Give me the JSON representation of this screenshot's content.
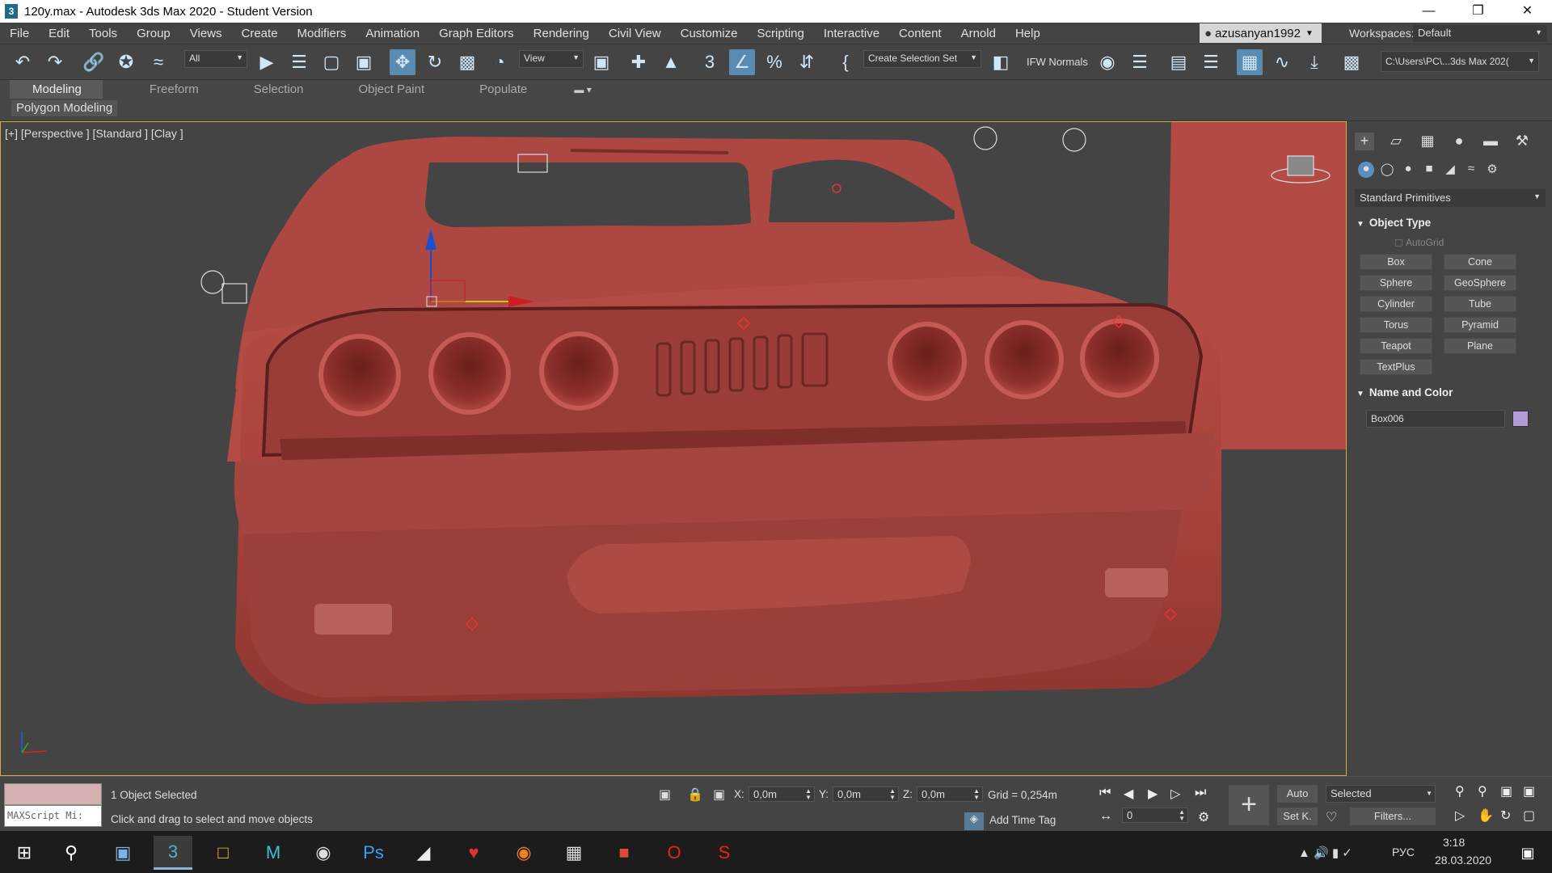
{
  "window": {
    "title": "120y.max - Autodesk 3ds Max 2020 - Student Version",
    "controls": [
      "—",
      "❐",
      "✕"
    ]
  },
  "menu": {
    "items": [
      "File",
      "Edit",
      "Tools",
      "Group",
      "Views",
      "Create",
      "Modifiers",
      "Animation",
      "Graph Editors",
      "Rendering",
      "Civil View",
      "Customize",
      "Scripting",
      "Interactive",
      "Content",
      "Arnold",
      "Help"
    ],
    "user": "azusanyan1992",
    "workspaces_label": "Workspaces:",
    "workspace": "Default"
  },
  "toolbar": {
    "filter": "All",
    "ref_coord": "View",
    "selection_set": "Create Selection Set",
    "ifw": "IFW Normals",
    "project_path": "C:\\Users\\PC\\...3ds Max 202("
  },
  "ribbon": {
    "tabs": [
      "Modeling",
      "Freeform",
      "Selection",
      "Object Paint",
      "Populate"
    ],
    "active": "Modeling",
    "sub": "Polygon Modeling"
  },
  "viewport": {
    "label": "[+] [Perspective ] [Standard ] [Clay ]",
    "object_color": "#b54a43"
  },
  "command_panel": {
    "category": "Standard Primitives",
    "object_type": "Object Type",
    "autogrid": "AutoGrid",
    "buttons": [
      "Box",
      "Cone",
      "Sphere",
      "GeoSphere",
      "Cylinder",
      "Tube",
      "Torus",
      "Pyramid",
      "Teapot",
      "Plane",
      "TextPlus"
    ],
    "name_and_color": "Name and Color",
    "object_name": "Box006",
    "object_swatch": "#b59ad8"
  },
  "status": {
    "maxscript": "MAXScript Mi:",
    "selected": "1 Object Selected",
    "hint": "Click and drag to select and move objects",
    "x": "0,0m",
    "y": "0,0m",
    "z": "0,0m",
    "x_label": "X:",
    "y_label": "Y:",
    "z_label": "Z:",
    "grid": "Grid = 0,254m",
    "add_time_tag": "Add Time Tag",
    "auto": "Auto",
    "set_key": "Set K.",
    "key_mode": "Selected",
    "filters": "Filters...",
    "frame": "0"
  },
  "taskbar": {
    "lang": "РУС",
    "time": "3:18",
    "date": "28.03.2020"
  }
}
